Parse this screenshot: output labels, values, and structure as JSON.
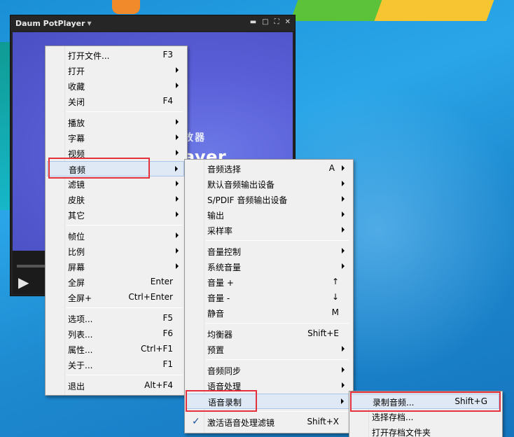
{
  "player": {
    "title": "Daum PotPlayer",
    "brand_sub": "放器",
    "brand": "ayer"
  },
  "main_menu": [
    {
      "label": "打开文件...",
      "shortcut": "F3"
    },
    {
      "label": "打开",
      "arrow": true
    },
    {
      "label": "收藏",
      "arrow": true
    },
    {
      "label": "关闭",
      "shortcut": "F4"
    },
    {
      "label": "播放",
      "arrow": true
    },
    {
      "label": "字幕",
      "arrow": true
    },
    {
      "label": "视频",
      "arrow": true
    },
    {
      "label": "音频",
      "arrow": true,
      "highlighted": true
    },
    {
      "label": "滤镜",
      "arrow": true
    },
    {
      "label": "皮肤",
      "arrow": true
    },
    {
      "label": "其它",
      "arrow": true
    },
    {
      "label": "帧位",
      "arrow": true
    },
    {
      "label": "比例",
      "arrow": true
    },
    {
      "label": "屏幕",
      "arrow": true
    },
    {
      "label": "全屏",
      "shortcut": "Enter"
    },
    {
      "label": "全屏+",
      "shortcut": "Ctrl+Enter"
    },
    {
      "label": "选项...",
      "shortcut": "F5"
    },
    {
      "label": "列表...",
      "shortcut": "F6"
    },
    {
      "label": "属性...",
      "shortcut": "Ctrl+F1"
    },
    {
      "label": "关于...",
      "shortcut": "F1"
    },
    {
      "label": "退出",
      "shortcut": "Alt+F4"
    }
  ],
  "audio_menu": [
    {
      "label": "音频选择",
      "shortcut": "A",
      "arrow": true
    },
    {
      "label": "默认音频输出设备",
      "arrow": true
    },
    {
      "label": "S/PDIF 音频输出设备",
      "arrow": true
    },
    {
      "label": "输出",
      "arrow": true
    },
    {
      "label": "采样率",
      "arrow": true
    },
    {
      "label": "音量控制",
      "arrow": true
    },
    {
      "label": "系统音量",
      "arrow": true
    },
    {
      "label": "音量 +",
      "shortcut": "↑"
    },
    {
      "label": "音量 -",
      "shortcut": "↓"
    },
    {
      "label": "静音",
      "shortcut": "M"
    },
    {
      "label": "均衡器",
      "shortcut": "Shift+E"
    },
    {
      "label": "预置",
      "arrow": true
    },
    {
      "label": "音频同步",
      "arrow": true
    },
    {
      "label": "语音处理",
      "arrow": true
    },
    {
      "label": "语音录制",
      "arrow": true,
      "highlighted": true
    },
    {
      "label": "激活语音处理滤镜",
      "shortcut": "Shift+X",
      "checked": true
    }
  ],
  "record_menu": [
    {
      "label": "录制音频...",
      "shortcut": "Shift+G",
      "highlighted": true
    },
    {
      "label": "选择存档..."
    },
    {
      "label": "打开存档文件夹"
    }
  ],
  "icons": {
    "check": "✓",
    "play": "▶",
    "title_caret": "▼",
    "window_buttons": [
      "▬",
      "□",
      "⛶",
      "✕"
    ]
  }
}
